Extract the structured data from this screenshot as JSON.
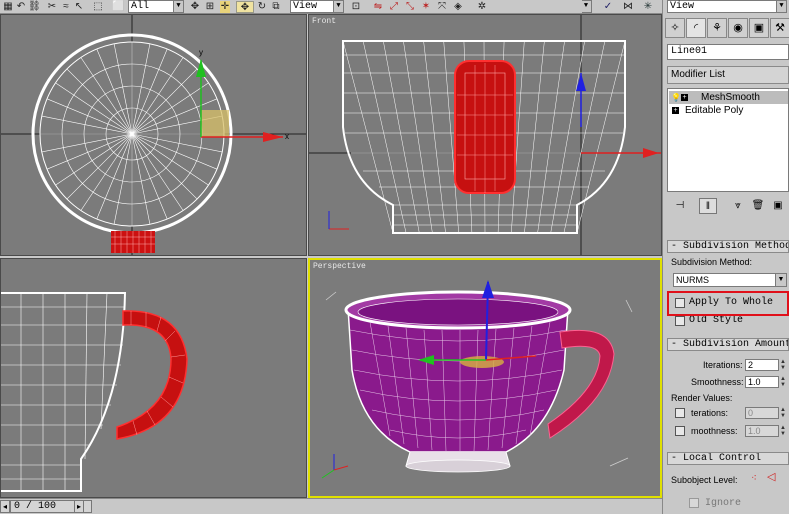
{
  "toolbar": {
    "selection_filter": "All",
    "ref_coord_system": "View",
    "ref_coord_system_2": "View"
  },
  "viewports": {
    "front_label": "Front",
    "perspective_label": "Perspective"
  },
  "timeline": {
    "frame_display": "0 / 100"
  },
  "command_panel": {
    "object_name": "Line01",
    "modifier_list": "Modifier List",
    "stack": [
      {
        "label": "MeshSmooth",
        "selected": true
      },
      {
        "label": "Editable Poly",
        "selected": false
      }
    ],
    "subdivision_method": {
      "title": "Subdivision Method",
      "label": "Subdivision Method:",
      "value": "NURMS",
      "apply_to_whole": "Apply To Whole",
      "old_style": "Old Style"
    },
    "subdivision_amount": {
      "title": "Subdivision Amount",
      "iterations_label": "Iterations:",
      "iterations_value": "2",
      "smoothness_label": "Smoothness:",
      "smoothness_value": "1.0",
      "render_values_label": "Render Values:",
      "render_iterations_label": "terations:",
      "render_iterations_value": "0",
      "render_smoothness_label": "moothness:",
      "render_smoothness_value": "1.0"
    },
    "local_control": {
      "title": "Local Control",
      "subobject_label": "Subobject Level:",
      "ignore_label": "Ignore"
    }
  },
  "colors": {
    "viewport_bg": "#7b7b7b",
    "wire_white": "#ffffff",
    "wire_red": "#dd1111",
    "cup_purple": "#8a1a8c",
    "active_viewport_border": "#e0e000",
    "annotation_red": "#e0101a"
  }
}
